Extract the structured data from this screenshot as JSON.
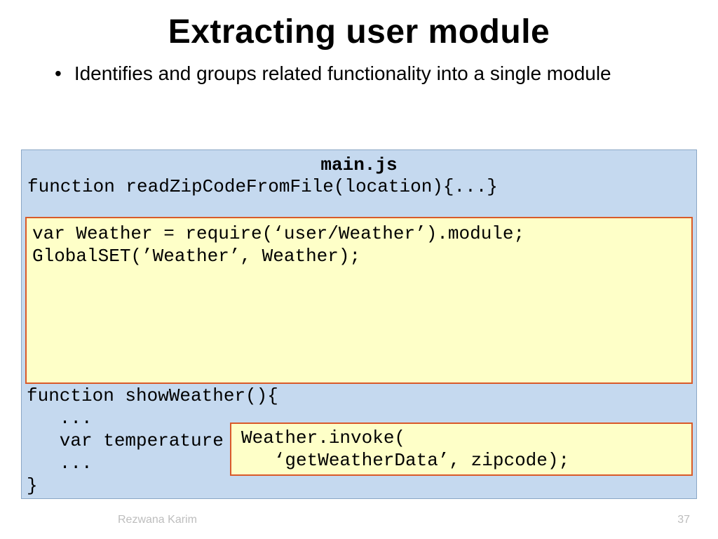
{
  "title": "Extracting user module",
  "bullet": "Identifies and groups related functionality into a single module",
  "file_label": "main.js",
  "code_top": "function readZipCodeFromFile(location){...}",
  "overlay1_line1": "var Weather = require(‘user/Weather’).module;",
  "overlay1_line2": "GlobalSET(’Weather’, Weather);",
  "bottom_line1": "function showWeather(){",
  "bottom_line2": "   ...",
  "bottom_line3": "   var temperature =",
  "bottom_line4": "   ...",
  "bottom_line5": "}",
  "overlay2_line1": "Weather.invoke(",
  "overlay2_line2": "   ‘getWeatherData’, zipcode);",
  "footer_author": "Rezwana Karim",
  "footer_page": "37"
}
